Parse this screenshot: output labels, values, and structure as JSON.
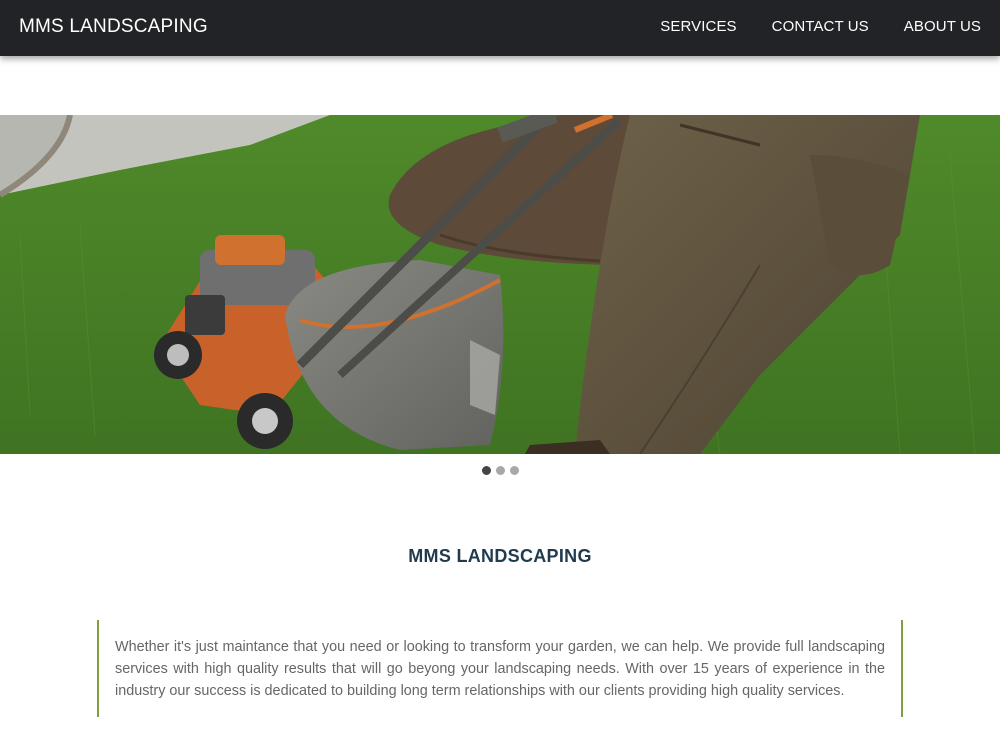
{
  "navbar": {
    "brand": "MMS LANDSCAPING",
    "links": [
      "SERVICES",
      "CONTACT US",
      "ABOUT US"
    ]
  },
  "carousel": {
    "slide_count": 3,
    "active_index": 0
  },
  "intro": {
    "title": "MMS LANDSCAPING",
    "body": "Whether it's just maintance that you need or looking to transform your garden, we can help. We provide full landscaping services with high quality results that will go beyong your landscaping needs. With over 15 years of experience in the industry our success is dedicated to building long term relationships with our clients providing high quality services."
  },
  "colors": {
    "navbar_bg": "#222327",
    "title": "#1f3b4d",
    "accent_border": "#7da13a",
    "body_text": "#666666"
  }
}
